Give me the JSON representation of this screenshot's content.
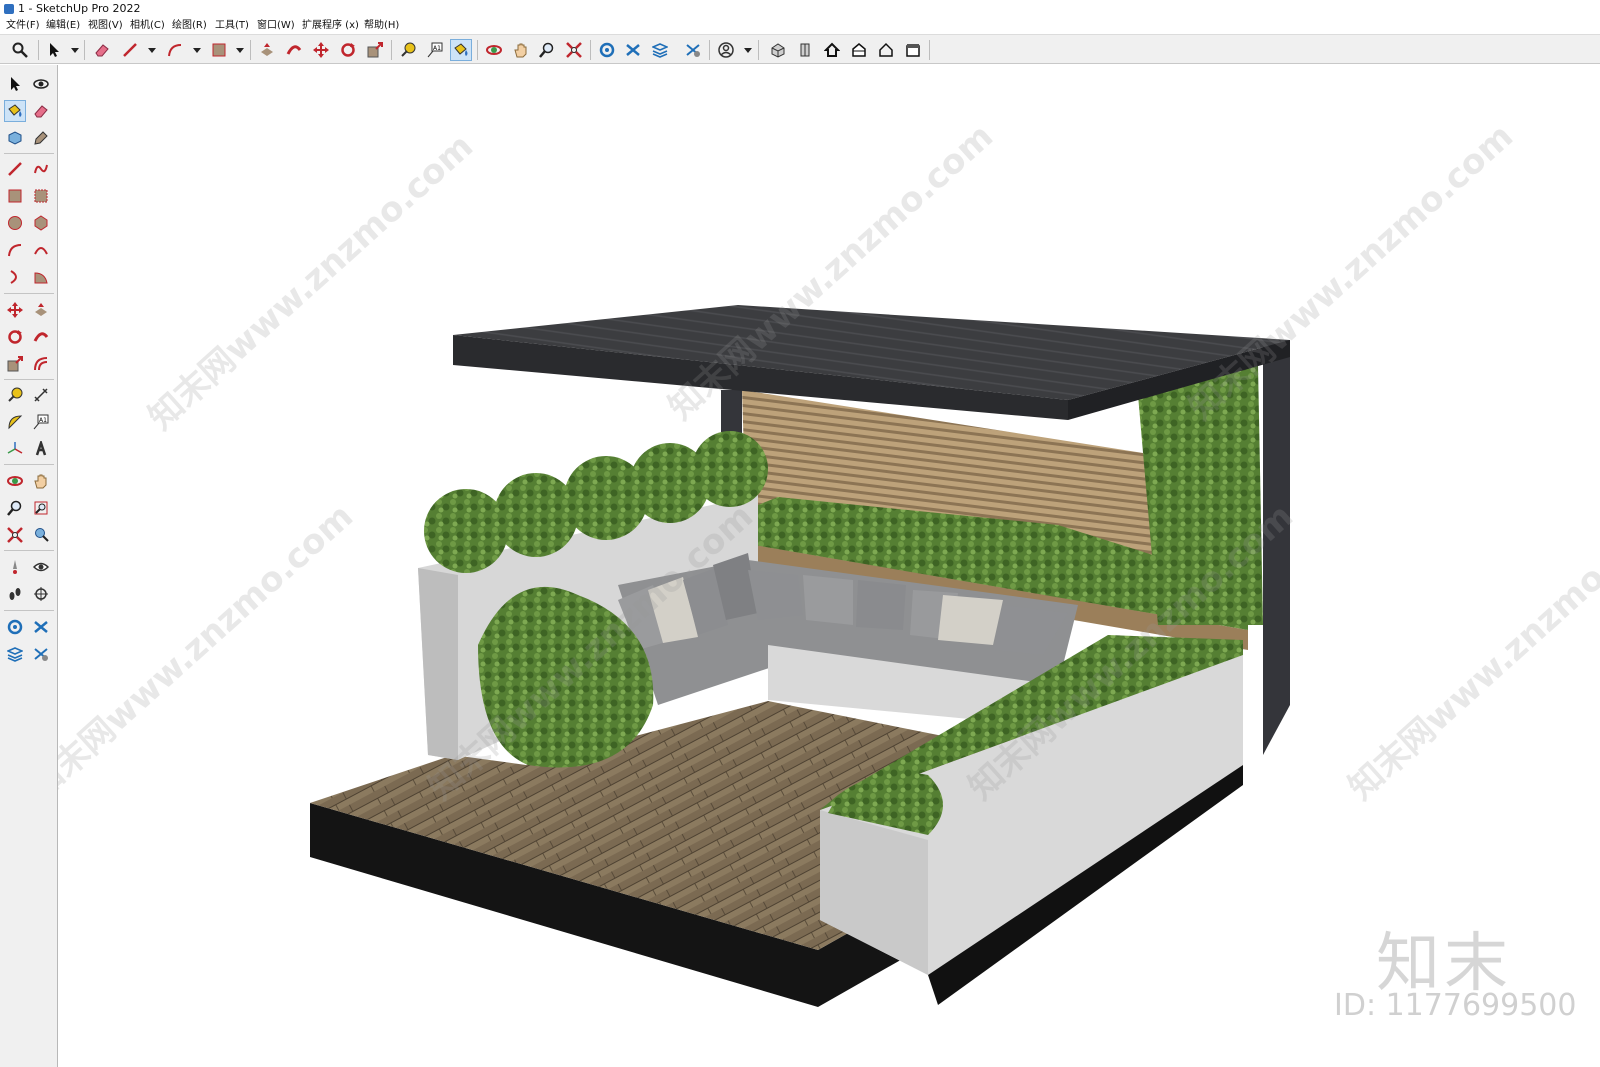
{
  "window": {
    "title": "1 - SketchUp Pro 2022"
  },
  "menubar": {
    "items": [
      {
        "label": "文件(F)"
      },
      {
        "label": "编辑(E)"
      },
      {
        "label": "视图(V)"
      },
      {
        "label": "相机(C)"
      },
      {
        "label": "绘图(R)"
      },
      {
        "label": "工具(T)"
      },
      {
        "label": "窗口(W)"
      },
      {
        "label": "扩展程序 (x)"
      },
      {
        "label": "帮助(H)"
      }
    ]
  },
  "toolbar": {
    "icons": [
      "search-icon",
      "select-icon",
      "eraser-icon",
      "pencil-icon",
      "arc-icon",
      "rectangle-icon",
      "pushpull-icon",
      "followme-icon",
      "move-icon",
      "rotate-icon",
      "scale-icon",
      "tape-icon",
      "text-icon",
      "paint-icon",
      "orbit-icon",
      "pan-icon",
      "zoom-icon",
      "zoom-extents-icon",
      "warehouse-icon",
      "extension-icon",
      "layers-icon",
      "styles-icon",
      "user-icon",
      "iso-view-icon",
      "side-view-icon",
      "top-view-icon",
      "front-view-icon",
      "back-view-icon",
      "right-view-icon"
    ],
    "active": "paint-icon"
  },
  "left_toolbar": {
    "icons": [
      "select-icon",
      "orbit-icon",
      "paint-icon",
      "eraser-icon",
      "component-icon",
      "tag-icon",
      "pencil-icon",
      "freehand-icon",
      "rectangle-icon",
      "rotated-rect-icon",
      "circle-icon",
      "polygon-icon",
      "arc-icon",
      "arc2-icon",
      "pie-icon",
      "arc3-icon",
      "move-icon",
      "pushpull-icon",
      "rotate-icon",
      "followme-icon",
      "scale-icon",
      "offset-icon",
      "tape-icon",
      "dimension-icon",
      "protractor-icon",
      "text-icon",
      "axes-icon",
      "3dtext-icon",
      "orbit2-icon",
      "pan-icon",
      "zoom-icon",
      "zoom-window-icon",
      "zoom-extents-icon",
      "previous-view-icon",
      "position-camera-icon",
      "look-around-icon",
      "walk-icon",
      "section-icon",
      "warehouse-icon",
      "extension-icon",
      "layers-icon",
      "styles-icon"
    ],
    "active": "paint-icon"
  },
  "canvas": {
    "watermark_text": "知末网www.znzmo.com",
    "logo_text": "知末",
    "id_text": "ID: 1177699500"
  },
  "colors": {
    "pergola": "#3a3b3d",
    "wood_slats": "#b79c72",
    "deck": "#7a6a52",
    "deck_edge": "#141414",
    "planter": "#d9d9d9",
    "sofa": "#8f9092",
    "plants": "#4f7a2f"
  }
}
